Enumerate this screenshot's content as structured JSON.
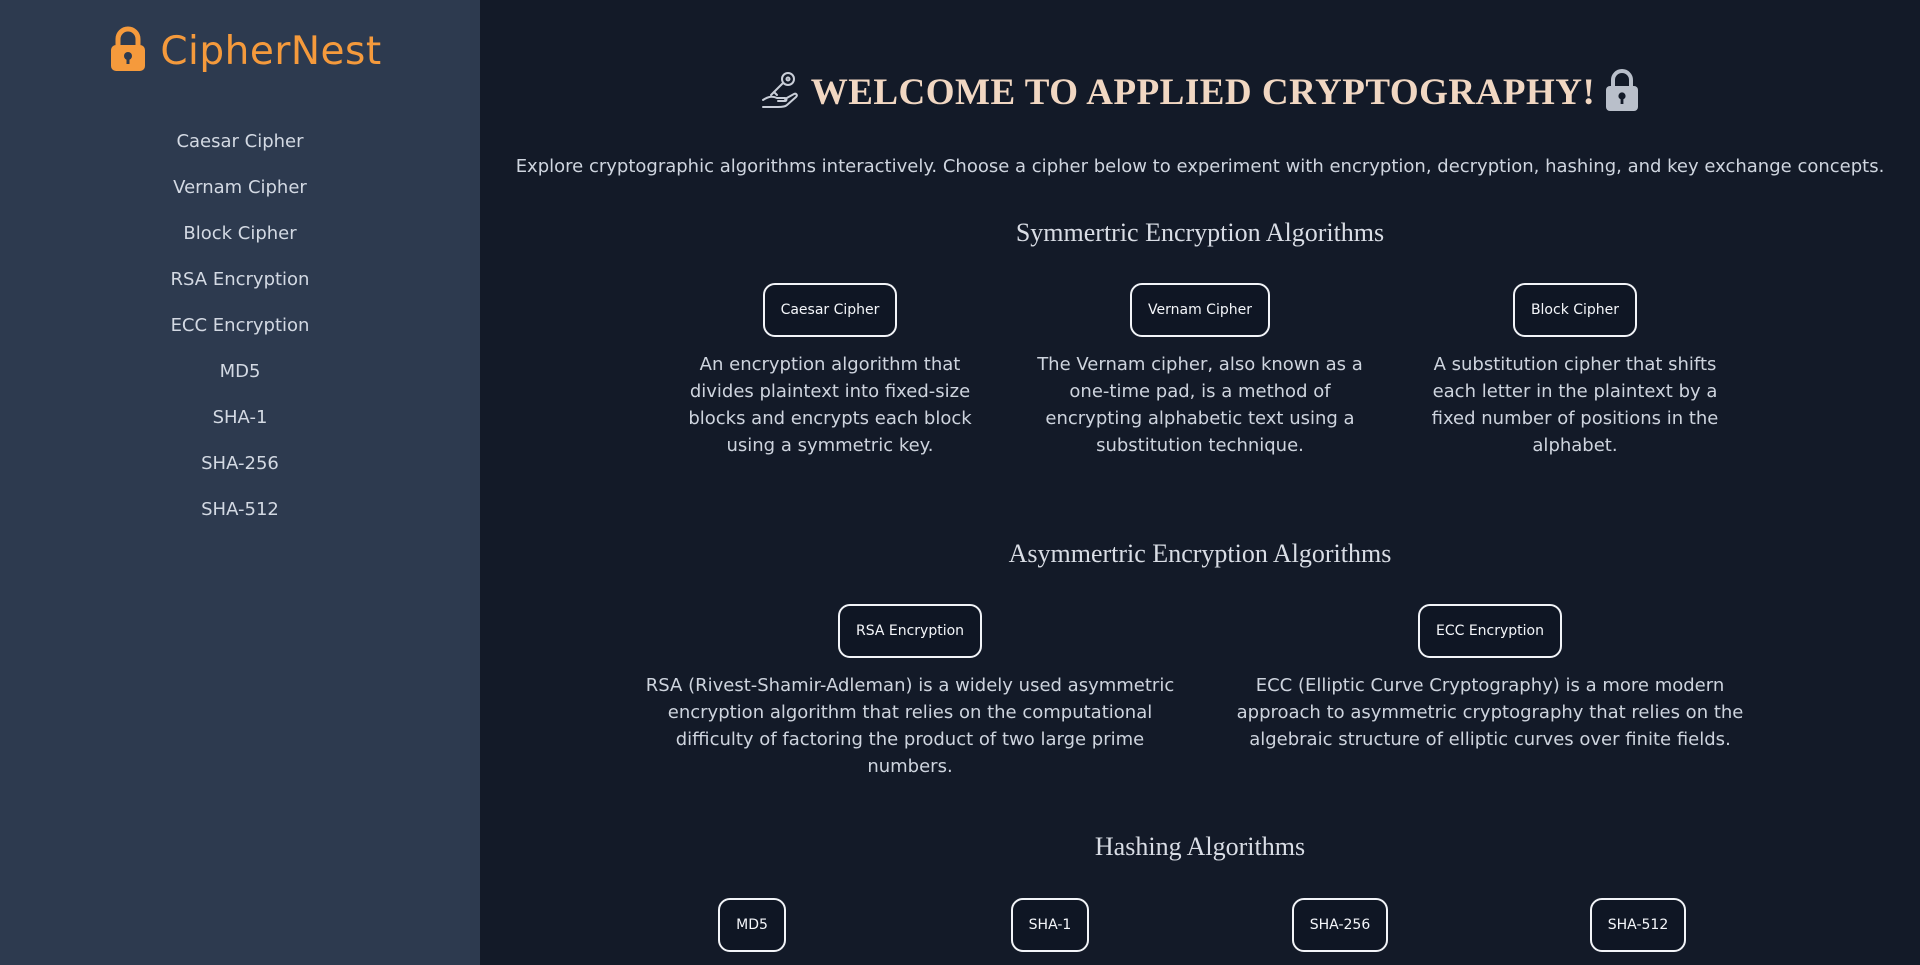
{
  "brand": {
    "name": "CipherNest",
    "icon": "lock-icon",
    "color": "#f59a3c"
  },
  "sidebar": {
    "items": [
      {
        "label": "Caesar Cipher"
      },
      {
        "label": "Vernam Cipher"
      },
      {
        "label": "Block Cipher"
      },
      {
        "label": "RSA Encryption"
      },
      {
        "label": "ECC Encryption"
      },
      {
        "label": "MD5"
      },
      {
        "label": "SHA-1"
      },
      {
        "label": "SHA-256"
      },
      {
        "label": "SHA-512"
      }
    ]
  },
  "header": {
    "title": "WELCOME TO APPLIED CRYPTOGRAPHY!",
    "left_icon": "key-hand-icon",
    "right_icon": "lock-icon"
  },
  "intro": "Explore cryptographic algorithms interactively. Choose a cipher below to experiment with encryption, decryption, hashing, and key exchange concepts.",
  "sections": {
    "symmetric": {
      "title": "Symmertric Encryption Algorithms",
      "cards": [
        {
          "button": "Caesar Cipher",
          "description": "An encryption algorithm that divides plaintext into fixed-size blocks and encrypts each block using a symmetric key."
        },
        {
          "button": "Vernam Cipher",
          "description": "The Vernam cipher, also known as a one-time pad, is a method of encrypting alphabetic text using a substitution technique."
        },
        {
          "button": "Block Cipher",
          "description": "A substitution cipher that shifts each letter in the plaintext by a fixed number of positions in the alphabet."
        }
      ]
    },
    "asymmetric": {
      "title": "Asymmertric Encryption Algorithms",
      "cards": [
        {
          "button": "RSA Encryption",
          "description": "RSA (Rivest-Shamir-Adleman) is a widely used asymmetric encryption algorithm that relies on the computational difficulty of factoring the product of two large prime numbers."
        },
        {
          "button": "ECC Encryption",
          "description": "ECC (Elliptic Curve Cryptography) is a more modern approach to asymmetric cryptography that relies on the algebraic structure of elliptic curves over finite fields."
        }
      ]
    },
    "hashing": {
      "title": "Hashing Algorithms",
      "cards": [
        {
          "button": "MD5"
        },
        {
          "button": "SHA-1"
        },
        {
          "button": "SHA-256"
        },
        {
          "button": "SHA-512"
        }
      ]
    }
  }
}
